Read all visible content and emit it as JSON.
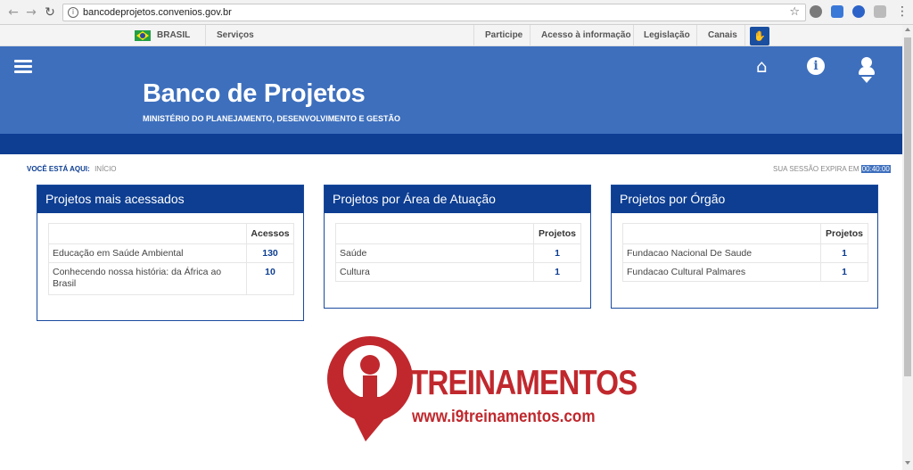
{
  "browser": {
    "url": "bancodeprojetos.convenios.gov.br"
  },
  "govbar": {
    "country": "BRASIL",
    "services": "Serviços",
    "links": [
      "Participe",
      "Acesso à informação",
      "Legislação",
      "Canais"
    ]
  },
  "header": {
    "title": "Banco de Projetos",
    "subtitle": "MINISTÉRIO DO PLANEJAMENTO, DESENVOLVIMENTO E GESTÃO"
  },
  "breadcrumb": {
    "label": "VOCÊ ESTÁ AQUI:",
    "current": "INÍCIO"
  },
  "session": {
    "label": "SUA SESSÃO EXPIRA EM",
    "timer": "00:40:00"
  },
  "panels": [
    {
      "title": "Projetos mais acessados",
      "column": "Acessos",
      "rows": [
        {
          "name": "Educação em Saúde Ambiental",
          "value": "130"
        },
        {
          "name": "Conhecendo nossa história: da África ao Brasil",
          "value": "10"
        }
      ]
    },
    {
      "title": "Projetos por Área de Atuação",
      "column": "Projetos",
      "rows": [
        {
          "name": "Saúde",
          "value": "1"
        },
        {
          "name": "Cultura",
          "value": "1"
        }
      ]
    },
    {
      "title": "Projetos por Órgão",
      "column": "Projetos",
      "rows": [
        {
          "name": "Fundacao Nacional De Saude",
          "value": "1"
        },
        {
          "name": "Fundacao Cultural Palmares",
          "value": "1"
        }
      ]
    }
  ],
  "watermark": {
    "brand": "TREINAMENTOS",
    "url": "www.i9treinamentos.com"
  },
  "colors": {
    "header_blue": "#3d6fbd",
    "dark_blue": "#0d3e92",
    "brand_red": "#c0282d"
  }
}
